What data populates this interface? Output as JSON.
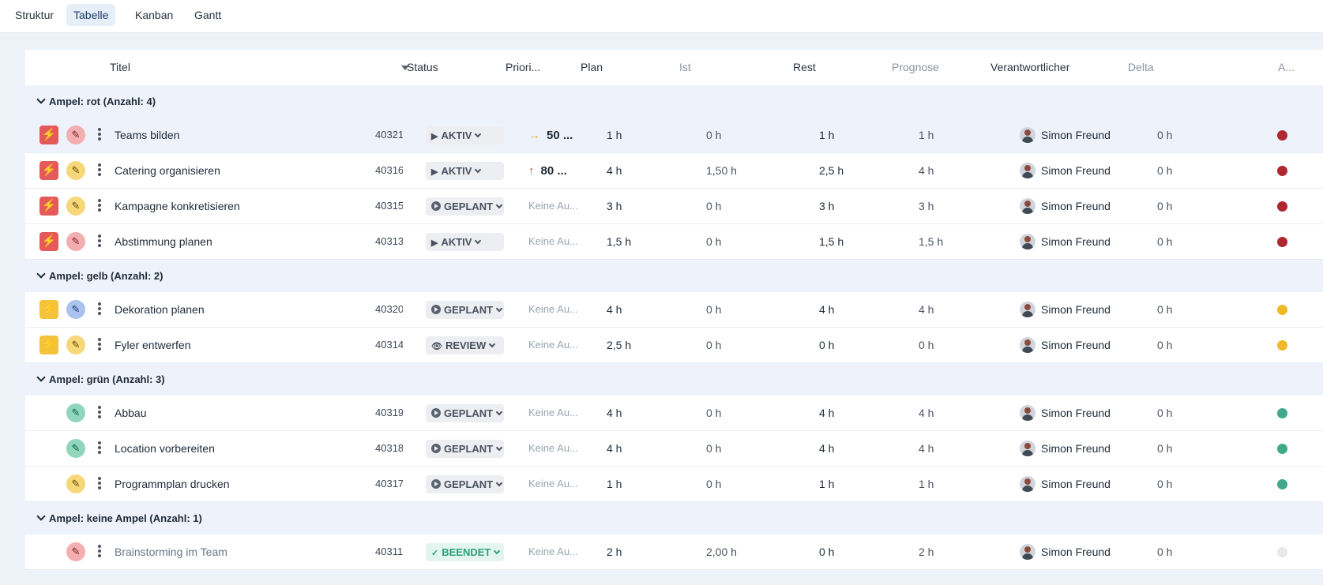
{
  "tabs": [
    {
      "label": "Struktur",
      "active": false
    },
    {
      "label": "Tabelle",
      "active": true
    },
    {
      "label": "Kanban",
      "active": false
    },
    {
      "label": "Gantt",
      "active": false
    }
  ],
  "columns": {
    "titel": "Titel",
    "status": "Status",
    "prioritaet": "Priori...",
    "plan": "Plan",
    "ist": "Ist",
    "rest": "Rest",
    "prognose": "Prognose",
    "verantwortlicher": "Verantwortlicher",
    "delta": "Delta",
    "ampel": "A..."
  },
  "colors": {
    "ampel_rot": "#b0282f",
    "ampel_gelb": "#f0b928",
    "ampel_gruen": "#3fa98a",
    "ampel_keine": "#e6e8eb",
    "bolt_red": "#e45a5a",
    "bolt_yellow": "#f3c33c",
    "prio_orange": "#f0a531",
    "prio_red": "#e0453f"
  },
  "groups": [
    {
      "label": "Ampel: rot (Anzahl: 4)",
      "rows": [
        {
          "bolt": "red",
          "pencil": "red",
          "title": "Teams bilden",
          "id": "40321",
          "status": "AKTIV",
          "status_icon": "play",
          "prio_arrow": "→",
          "prio_color": "orange",
          "prio": "50 ...",
          "plan": "1 h",
          "ist": "0 h",
          "rest": "1 h",
          "prognose": "1 h",
          "verantwortlicher": "Simon Freund",
          "delta": "0 h",
          "ampel": "rot",
          "highlight": true
        },
        {
          "bolt": "red",
          "pencil": "yellow",
          "title": "Catering organisieren",
          "id": "40316",
          "status": "AKTIV",
          "status_icon": "play",
          "prio_arrow": "↑",
          "prio_color": "red",
          "prio": "80 ...",
          "plan": "4 h",
          "ist": "1,50 h",
          "rest": "2,5 h",
          "prognose": "4 h",
          "verantwortlicher": "Simon Freund",
          "delta": "0 h",
          "ampel": "rot"
        },
        {
          "bolt": "red",
          "pencil": "yellow",
          "title": "Kampagne konkretisieren",
          "id": "40315",
          "status": "GEPLANT",
          "status_icon": "dot",
          "prio": "Keine Au...",
          "plan": "3 h",
          "ist": "0 h",
          "rest": "3 h",
          "prognose": "3 h",
          "verantwortlicher": "Simon Freund",
          "delta": "0 h",
          "ampel": "rot"
        },
        {
          "bolt": "red",
          "pencil": "red",
          "title": "Abstimmung planen",
          "id": "40313",
          "status": "AKTIV",
          "status_icon": "play",
          "prio": "Keine Au...",
          "plan": "1,5 h",
          "ist": "0 h",
          "rest": "1,5 h",
          "prognose": "1,5 h",
          "verantwortlicher": "Simon Freund",
          "delta": "0 h",
          "ampel": "rot"
        }
      ]
    },
    {
      "label": "Ampel: gelb (Anzahl: 2)",
      "rows": [
        {
          "bolt": "yellow",
          "pencil": "blue",
          "title": "Dekoration planen",
          "id": "40320",
          "status": "GEPLANT",
          "status_icon": "dot",
          "prio": "Keine Au...",
          "plan": "4 h",
          "ist": "0 h",
          "rest": "4 h",
          "prognose": "4 h",
          "verantwortlicher": "Simon Freund",
          "delta": "0 h",
          "ampel": "gelb"
        },
        {
          "bolt": "yellow",
          "pencil": "yellow",
          "title": "Fyler entwerfen",
          "id": "40314",
          "status": "REVIEW",
          "status_icon": "eye",
          "prio": "Keine Au...",
          "plan": "2,5 h",
          "ist": "0 h",
          "rest": "0 h",
          "prognose": "0 h",
          "verantwortlicher": "Simon Freund",
          "delta": "0 h",
          "ampel": "gelb"
        }
      ]
    },
    {
      "label": "Ampel: grün (Anzahl: 3)",
      "rows": [
        {
          "pencil": "green",
          "title": "Abbau",
          "id": "40319",
          "status": "GEPLANT",
          "status_icon": "dot",
          "prio": "Keine Au...",
          "plan": "4 h",
          "ist": "0 h",
          "rest": "4 h",
          "prognose": "4 h",
          "verantwortlicher": "Simon Freund",
          "delta": "0 h",
          "ampel": "gruen"
        },
        {
          "pencil": "green",
          "title": "Location vorbereiten",
          "id": "40318",
          "status": "GEPLANT",
          "status_icon": "dot",
          "prio": "Keine Au...",
          "plan": "4 h",
          "ist": "0 h",
          "rest": "4 h",
          "prognose": "4 h",
          "verantwortlicher": "Simon Freund",
          "delta": "0 h",
          "ampel": "gruen"
        },
        {
          "pencil": "yellow",
          "title": "Programmplan drucken",
          "id": "40317",
          "status": "GEPLANT",
          "status_icon": "dot",
          "prio": "Keine Au...",
          "plan": "1 h",
          "ist": "0 h",
          "rest": "1 h",
          "prognose": "1 h",
          "verantwortlicher": "Simon Freund",
          "delta": "0 h",
          "ampel": "gruen"
        }
      ]
    },
    {
      "label": "Ampel: keine Ampel (Anzahl: 1)",
      "rows": [
        {
          "pencil": "red",
          "title": "Brainstorming im Team",
          "id": "40311",
          "status": "BEENDET",
          "status_icon": "check",
          "prio": "Keine Au...",
          "plan": "2 h",
          "ist": "2,00 h",
          "rest": "0 h",
          "prognose": "2 h",
          "verantwortlicher": "Simon Freund",
          "delta": "0 h",
          "ampel": "keine",
          "muted": true
        }
      ]
    }
  ]
}
